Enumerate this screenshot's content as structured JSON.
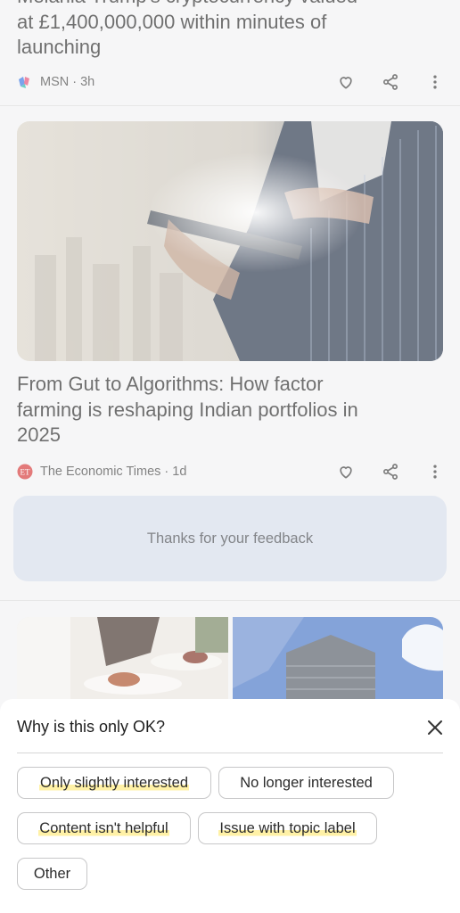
{
  "feed": {
    "article1": {
      "headline_partial": "Melania Trump's cryptocurrency valued",
      "headline_line2": "at £1,400,000,000 within minutes of",
      "headline_line3": "launching",
      "source": "MSN",
      "age": "3h",
      "meta": "MSN · 3h"
    },
    "article2": {
      "headline_line1": "From Gut to Algorithms: How factor",
      "headline_line2": "farming is reshaping Indian portfolios in",
      "headline_line3": "2025",
      "source_logo_text": "ET",
      "meta": "The Economic Times · 1d"
    },
    "feedback_text": "Thanks for your feedback"
  },
  "sheet": {
    "title": "Why is this only OK?",
    "options": [
      "Only slightly interested",
      "No longer interested",
      "Content isn't helpful",
      "Issue with topic label",
      "Other"
    ]
  },
  "icons": [
    "heart-icon",
    "share-icon",
    "more-vert-icon",
    "close-icon"
  ],
  "colors": {
    "feedback_bg": "#d3dbe9",
    "highlight": "#fff1a6",
    "et_red": "#d32f2f"
  }
}
